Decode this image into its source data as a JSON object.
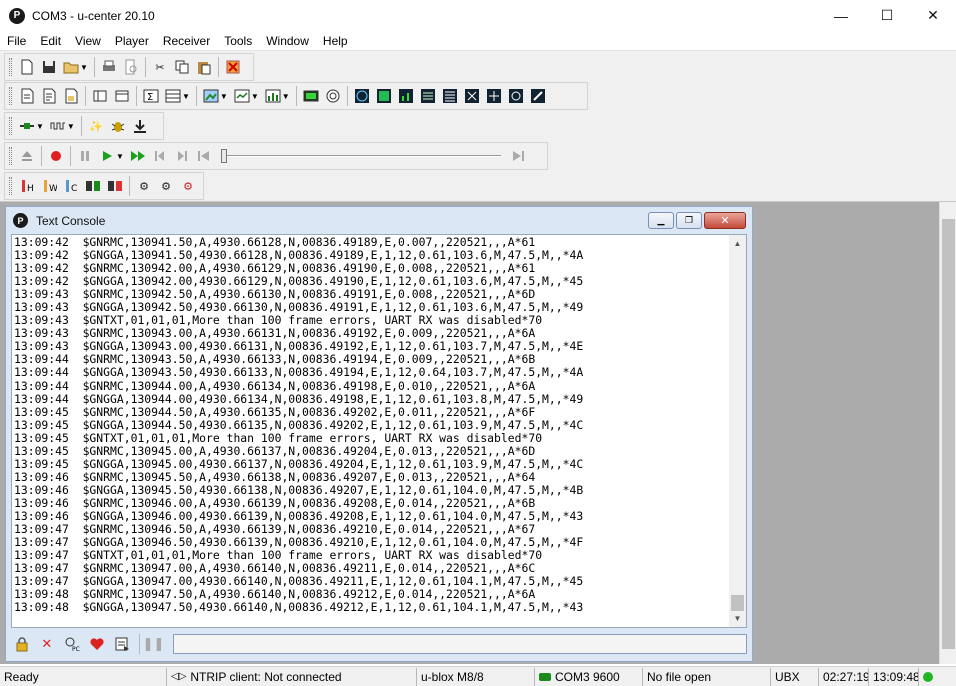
{
  "window": {
    "title": "COM3 - u-center 20.10",
    "app_icon_letter": "P",
    "minimize": "—",
    "maximize": "☐",
    "close": "✕"
  },
  "menu": [
    "File",
    "Edit",
    "View",
    "Player",
    "Receiver",
    "Tools",
    "Window",
    "Help"
  ],
  "console": {
    "title": "Text Console",
    "icon_letter": "P",
    "lines": [
      "13:09:42  $GNRMC,130941.50,A,4930.66128,N,00836.49189,E,0.007,,220521,,,A*61",
      "13:09:42  $GNGGA,130941.50,4930.66128,N,00836.49189,E,1,12,0.61,103.6,M,47.5,M,,*4A",
      "13:09:42  $GNRMC,130942.00,A,4930.66129,N,00836.49190,E,0.008,,220521,,,A*61",
      "13:09:42  $GNGGA,130942.00,4930.66129,N,00836.49190,E,1,12,0.61,103.6,M,47.5,M,,*45",
      "13:09:43  $GNRMC,130942.50,A,4930.66130,N,00836.49191,E,0.008,,220521,,,A*6D",
      "13:09:43  $GNGGA,130942.50,4930.66130,N,00836.49191,E,1,12,0.61,103.6,M,47.5,M,,*49",
      "13:09:43  $GNTXT,01,01,01,More than 100 frame errors, UART RX was disabled*70",
      "13:09:43  $GNRMC,130943.00,A,4930.66131,N,00836.49192,E,0.009,,220521,,,A*6A",
      "13:09:43  $GNGGA,130943.00,4930.66131,N,00836.49192,E,1,12,0.61,103.7,M,47.5,M,,*4E",
      "13:09:44  $GNRMC,130943.50,A,4930.66133,N,00836.49194,E,0.009,,220521,,,A*6B",
      "13:09:44  $GNGGA,130943.50,4930.66133,N,00836.49194,E,1,12,0.64,103.7,M,47.5,M,,*4A",
      "13:09:44  $GNRMC,130944.00,A,4930.66134,N,00836.49198,E,0.010,,220521,,,A*6A",
      "13:09:44  $GNGGA,130944.00,4930.66134,N,00836.49198,E,1,12,0.61,103.8,M,47.5,M,,*49",
      "13:09:45  $GNRMC,130944.50,A,4930.66135,N,00836.49202,E,0.011,,220521,,,A*6F",
      "13:09:45  $GNGGA,130944.50,4930.66135,N,00836.49202,E,1,12,0.61,103.9,M,47.5,M,,*4C",
      "13:09:45  $GNTXT,01,01,01,More than 100 frame errors, UART RX was disabled*70",
      "13:09:45  $GNRMC,130945.00,A,4930.66137,N,00836.49204,E,0.013,,220521,,,A*6D",
      "13:09:45  $GNGGA,130945.00,4930.66137,N,00836.49204,E,1,12,0.61,103.9,M,47.5,M,,*4C",
      "13:09:46  $GNRMC,130945.50,A,4930.66138,N,00836.49207,E,0.013,,220521,,,A*64",
      "13:09:46  $GNGGA,130945.50,4930.66138,N,00836.49207,E,1,12,0.61,104.0,M,47.5,M,,*4B",
      "13:09:46  $GNRMC,130946.00,A,4930.66139,N,00836.49208,E,0.014,,220521,,,A*6B",
      "13:09:46  $GNGGA,130946.00,4930.66139,N,00836.49208,E,1,12,0.61,104.0,M,47.5,M,,*43",
      "13:09:47  $GNRMC,130946.50,A,4930.66139,N,00836.49210,E,0.014,,220521,,,A*67",
      "13:09:47  $GNGGA,130946.50,4930.66139,N,00836.49210,E,1,12,0.61,104.0,M,47.5,M,,*4F",
      "13:09:47  $GNTXT,01,01,01,More than 100 frame errors, UART RX was disabled*70",
      "13:09:47  $GNRMC,130947.00,A,4930.66140,N,00836.49211,E,0.014,,220521,,,A*6C",
      "13:09:47  $GNGGA,130947.00,4930.66140,N,00836.49211,E,1,12,0.61,104.1,M,47.5,M,,*45",
      "13:09:48  $GNRMC,130947.50,A,4930.66140,N,00836.49212,E,0.014,,220521,,,A*6A",
      "13:09:48  $GNGGA,130947.50,4930.66140,N,00836.49212,E,1,12,0.61,104.1,M,47.5,M,,*43"
    ],
    "input_value": ""
  },
  "status": {
    "ready": "Ready",
    "ntrip": "NTRIP client: Not connected",
    "receiver": "u-blox M8/8",
    "port": "COM3 9600",
    "file": "No file open",
    "protocol": "UBX",
    "elapsed": "02:27:19",
    "clock": "13:09:48"
  },
  "colors": {
    "record": "#e02020",
    "play": "#1ca11c",
    "led_green": "#22b422",
    "close_red": "#c44a3a"
  }
}
